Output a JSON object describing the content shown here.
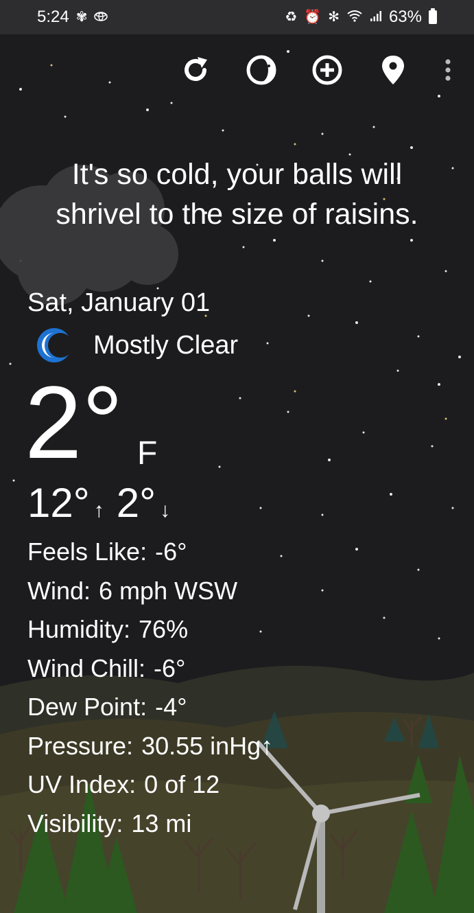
{
  "status_bar": {
    "time": "5:24",
    "battery": "63%",
    "icons": [
      "fan-icon",
      "toyota-icon",
      "recycle-icon",
      "alarm-icon",
      "bluetooth-icon",
      "wifi-icon",
      "signal-icon",
      "battery-icon"
    ]
  },
  "toolbar": {
    "icons": [
      "refresh-icon",
      "moon-phase-icon",
      "add-location-icon",
      "location-pin-icon",
      "more-vert-icon"
    ]
  },
  "quip": {
    "line1": "It's so cold, your balls will",
    "line2": "shrivel to the size of raisins."
  },
  "weather": {
    "date": "Sat, January 01",
    "condition": "Mostly Clear",
    "condition_icon": "crescent-moon-icon",
    "temperature": "2°",
    "unit": "F",
    "high": "12°",
    "low": "2°",
    "high_arrow": "↑",
    "low_arrow": "↓"
  },
  "details": [
    {
      "label": "Feels Like:",
      "value": "-6°"
    },
    {
      "label": "Wind:",
      "value": "6 mph WSW"
    },
    {
      "label": "Humidity:",
      "value": "76%"
    },
    {
      "label": "Wind Chill:",
      "value": "-6°"
    },
    {
      "label": "Dew Point:",
      "value": "-4°"
    },
    {
      "label": "Pressure:",
      "value": "30.55 inHg↑"
    },
    {
      "label": "UV Index:",
      "value": "0 of 12"
    },
    {
      "label": "Visibility:",
      "value": "13 mi"
    }
  ],
  "colors": {
    "sky": "#1c1c1e",
    "status_bar": "#2d2d2f",
    "moon_blue": "#1e73d2",
    "hill": "#3a3a2c",
    "tree": "#2d5a22"
  }
}
